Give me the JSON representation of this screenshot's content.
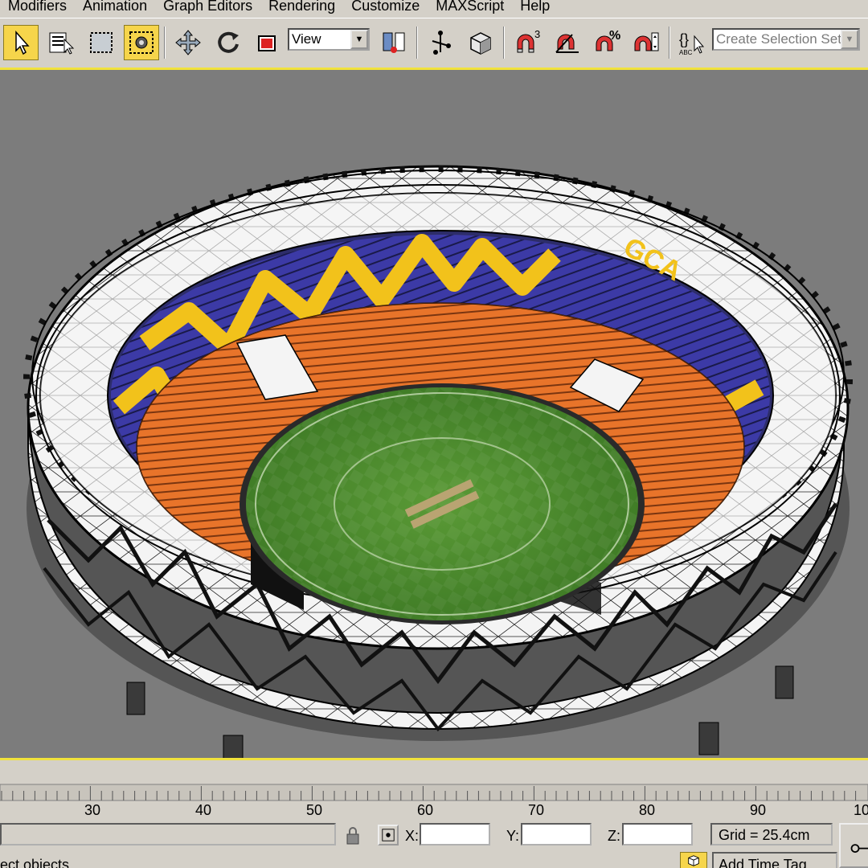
{
  "menu": {
    "items": [
      "Modifiers",
      "Animation",
      "Graph Editors",
      "Rendering",
      "Customize",
      "MAXScript",
      "Help"
    ]
  },
  "toolbar": {
    "reference_coord_value": "View",
    "selection_set_placeholder": "Create Selection Set",
    "snap_label": "3",
    "percent_snap_label": "%",
    "named_sel_label": "ABC",
    "active_tool": "select-object"
  },
  "viewport": {
    "background": "#7c7c7c",
    "active_border_color": "#f1e23c",
    "object_text": "GCA"
  },
  "timeline": {
    "ticks": [
      "30",
      "40",
      "50",
      "60",
      "70",
      "80",
      "90",
      "10"
    ]
  },
  "status": {
    "prompt_text": "ect objects",
    "x_label": "X:",
    "y_label": "Y:",
    "z_label": "Z:",
    "x_value": "",
    "y_value": "",
    "z_value": "",
    "grid_text": "Grid = 25.4cm",
    "add_time_tag": "Add Time Tag"
  },
  "colors": {
    "ui_gray": "#d4d0c8",
    "active_yellow": "#f6d54b",
    "field_green": "#4f8a2e",
    "seat_orange": "#e8742a",
    "upper_blue": "#3a3aa0",
    "stripe_yellow": "#f2c21b"
  }
}
